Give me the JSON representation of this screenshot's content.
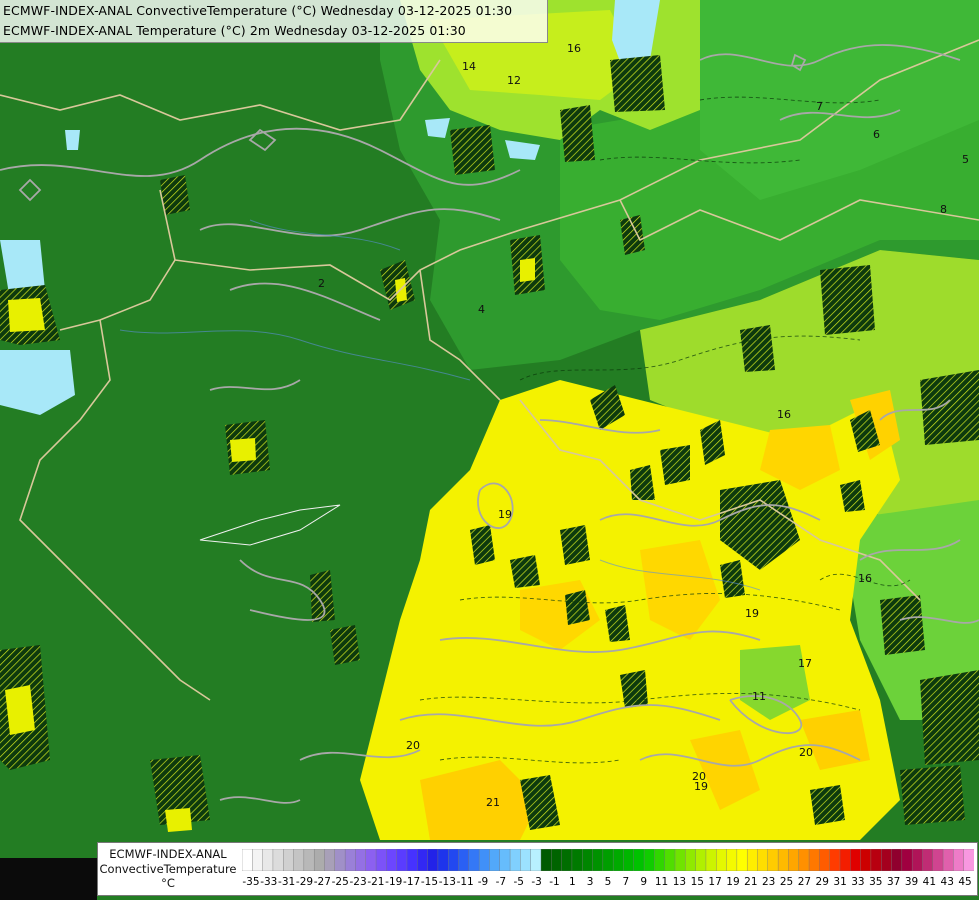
{
  "header": {
    "line1": "ECMWF-INDEX-ANAL ConvectiveTemperature (°C) Wednesday 03-12-2025 01:30",
    "line2": "ECMWF-INDEX-ANAL Temperature (°C) 2m Wednesday 03-12-2025 01:30"
  },
  "legend": {
    "title_line1": "ECMWF-INDEX-ANAL",
    "title_line2": "ConvectiveTemperature",
    "unit": "°C",
    "tick_labels": [
      "-35",
      "-33",
      "-31",
      "-29",
      "-27",
      "-25",
      "-23",
      "-21",
      "-19",
      "-17",
      "-15",
      "-13",
      "-11",
      "-9",
      "-7",
      "-5",
      "-3",
      "-1",
      "1",
      "3",
      "5",
      "7",
      "9",
      "11",
      "13",
      "15",
      "17",
      "19",
      "21",
      "23",
      "25",
      "27",
      "29",
      "31",
      "33",
      "35",
      "37",
      "39",
      "41",
      "43",
      "45"
    ],
    "colors": [
      "#ffffff",
      "#f4f4f4",
      "#e8e8e8",
      "#dcdcdc",
      "#d0d0d0",
      "#c4c4c4",
      "#b8b8b8",
      "#acacac",
      "#a8a0b8",
      "#a090c8",
      "#9a80d8",
      "#9470e4",
      "#8c60f0",
      "#7c52f8",
      "#6c46ff",
      "#5a3cff",
      "#4632ff",
      "#3228f4",
      "#2222e8",
      "#1e34ec",
      "#2248f0",
      "#2a60f4",
      "#3478f6",
      "#4090f8",
      "#52a8fa",
      "#66bcfc",
      "#80d0fe",
      "#9ce2ff",
      "#b8f0ff",
      "#005a00",
      "#006400",
      "#006e00",
      "#007a00",
      "#008600",
      "#009200",
      "#009e00",
      "#00aa00",
      "#00b600",
      "#00c200",
      "#10cc00",
      "#30d600",
      "#50de00",
      "#70e400",
      "#90ea00",
      "#b0f000",
      "#ccf400",
      "#e4f800",
      "#f4fa00",
      "#ffff00",
      "#ffee00",
      "#ffde00",
      "#ffcc00",
      "#ffba00",
      "#ffa600",
      "#ff9000",
      "#ff7800",
      "#ff5c00",
      "#ff3c00",
      "#f41e00",
      "#e00000",
      "#cc0000",
      "#b80010",
      "#a4001e",
      "#90002e",
      "#a00040",
      "#b01458",
      "#c02c74",
      "#d04490",
      "#e060ac",
      "#ee7cc8",
      "#f898e0"
    ]
  },
  "map": {
    "contour_labels": [
      "16",
      "14",
      "12",
      "7",
      "6",
      "5",
      "8",
      "2",
      "4",
      "16",
      "19",
      "19",
      "17",
      "19",
      "11",
      "20",
      "20",
      "21",
      "20",
      "16"
    ],
    "colors": {
      "dark_green": "#1f7a1f",
      "mid_green": "#2f9a2f",
      "light_green": "#46c02e",
      "lime": "#b8ea22",
      "yellow": "#f6f400",
      "orange_yellow": "#ffd000",
      "cyan": "#a8e8f8",
      "border_tan": "#d8c89a",
      "contour_gray": "#a8a8a8"
    }
  }
}
